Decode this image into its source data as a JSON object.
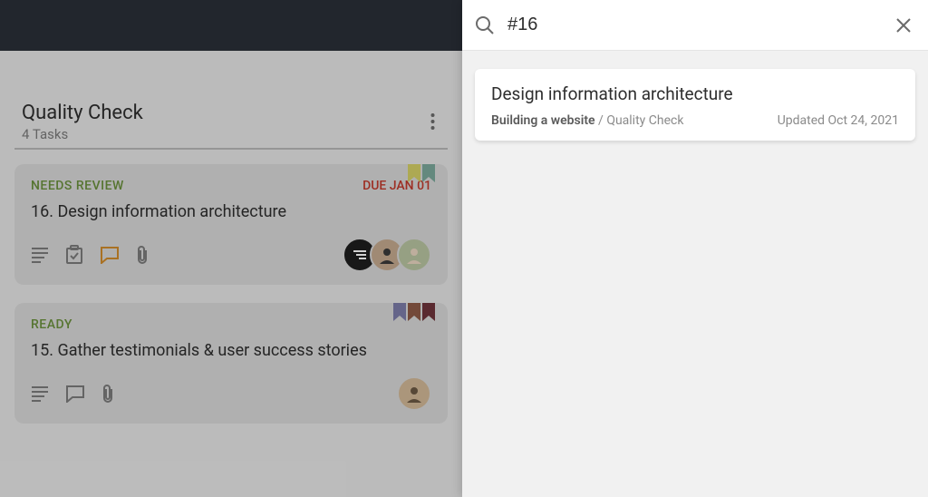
{
  "column": {
    "title": "Quality Check",
    "subtitle": "4 Tasks"
  },
  "cards": [
    {
      "status": "NEEDS REVIEW",
      "due": "DUE JAN 01",
      "title": "16. Design information architecture"
    },
    {
      "status": "READY",
      "due": "",
      "title": "15. Gather testimonials & user success stories"
    }
  ],
  "search": {
    "query": "#16"
  },
  "result": {
    "title": "Design information architecture",
    "project": "Building a website",
    "separator": " / ",
    "column": "Quality Check",
    "updated": "Updated Oct 24, 2021"
  }
}
